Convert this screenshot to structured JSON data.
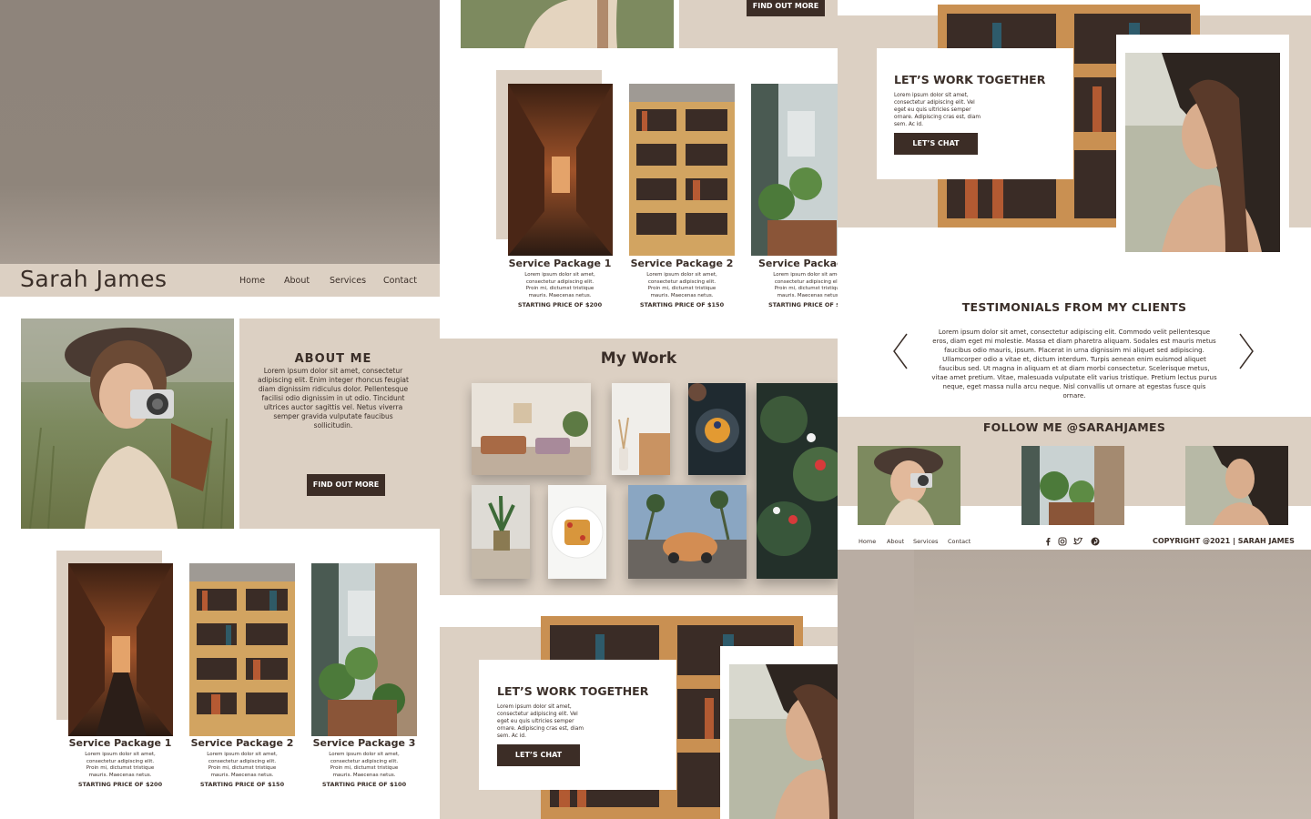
{
  "site": {
    "brand": "Sarah James"
  },
  "nav": {
    "home": "Home",
    "about": "About",
    "services": "Services",
    "contact": "Contact"
  },
  "about": {
    "title": "ABOUT ME",
    "text": "Lorem ipsum dolor sit amet, consectetur adipiscing elit. Enim integer rhoncus feugiat diam dignissim ridiculus dolor. Pellentesque facilisi odio dignissim in ut odio. Tincidunt ultrices auctor sagittis vel. Netus viverra semper gravida vulputate faucibus sollicitudin.",
    "button": "FIND OUT MORE"
  },
  "packages": [
    {
      "title": "Service Package 1",
      "desc": "Lorem ipsum dolor sit amet, consectetur adipiscing elit. Proin mi, dictumst tristique mauris. Maecenas netus.",
      "price": "STARTING PRICE OF $200"
    },
    {
      "title": "Service Package 2",
      "desc": "Lorem ipsum dolor sit amet, consectetur adipiscing elit. Proin mi, dictumst tristique mauris. Maecenas netus.",
      "price": "STARTING PRICE OF $150"
    },
    {
      "title": "Service Package 3",
      "desc": "Lorem ipsum dolor sit amet, consectetur adipiscing elit. Proin mi, dictumst tristique mauris. Maecenas netus.",
      "price": "STARTING PRICE OF $100"
    }
  ],
  "panel2": {
    "find_button": "FIND OUT MORE",
    "pkg3_title_partial": "Service Packag",
    "my_work_title": "My Work"
  },
  "work_together": {
    "title": "LET’S WORK TOGETHER",
    "text": "Lorem ipsum dolor sit amet, consectetur adipiscing elit. Vel eget eu quis ultricies semper ornare. Adipiscing cras est, diam sem. Ac id.",
    "button": "LET’S CHAT"
  },
  "testimonials": {
    "title": "TESTIMONIALS FROM MY CLIENTS",
    "text": "Lorem ipsum dolor sit amet, consectetur adipiscing elit. Commodo velit pellentesque eros, diam eget mi molestie. Massa et diam pharetra aliquam. Sodales est mauris metus faucibus odio mauris, ipsum. Placerat in urna dignissim mi aliquet sed adipiscing. Ullamcorper odio a vitae et, dictum interdum. Turpis aenean enim euismod aliquet faucibus sed. Ut magna in aliquam et at diam morbi consectetur. Scelerisque metus, vitae amet pretium. Vitae, malesuada vulputate elit varius tristique. Pretium lectus purus neque, eget massa nulla arcu neque. Nisl convallis ut ornare at egestas fusce quis ornare."
  },
  "follow": {
    "title": "FOLLOW ME @SARAHJAMES"
  },
  "footer": {
    "home": "Home",
    "about": "About",
    "services": "Services",
    "contact": "Contact",
    "copyright": "COPYRIGHT @2021  | SARAH JAMES"
  },
  "icons": [
    "facebook-icon",
    "instagram-icon",
    "twitter-icon",
    "pinterest-icon",
    "arrow-left-icon",
    "arrow-right-icon"
  ],
  "colors": {
    "beige": "#dcd0c3",
    "dark_brown": "#3c2d26",
    "text": "#3a2e28"
  }
}
